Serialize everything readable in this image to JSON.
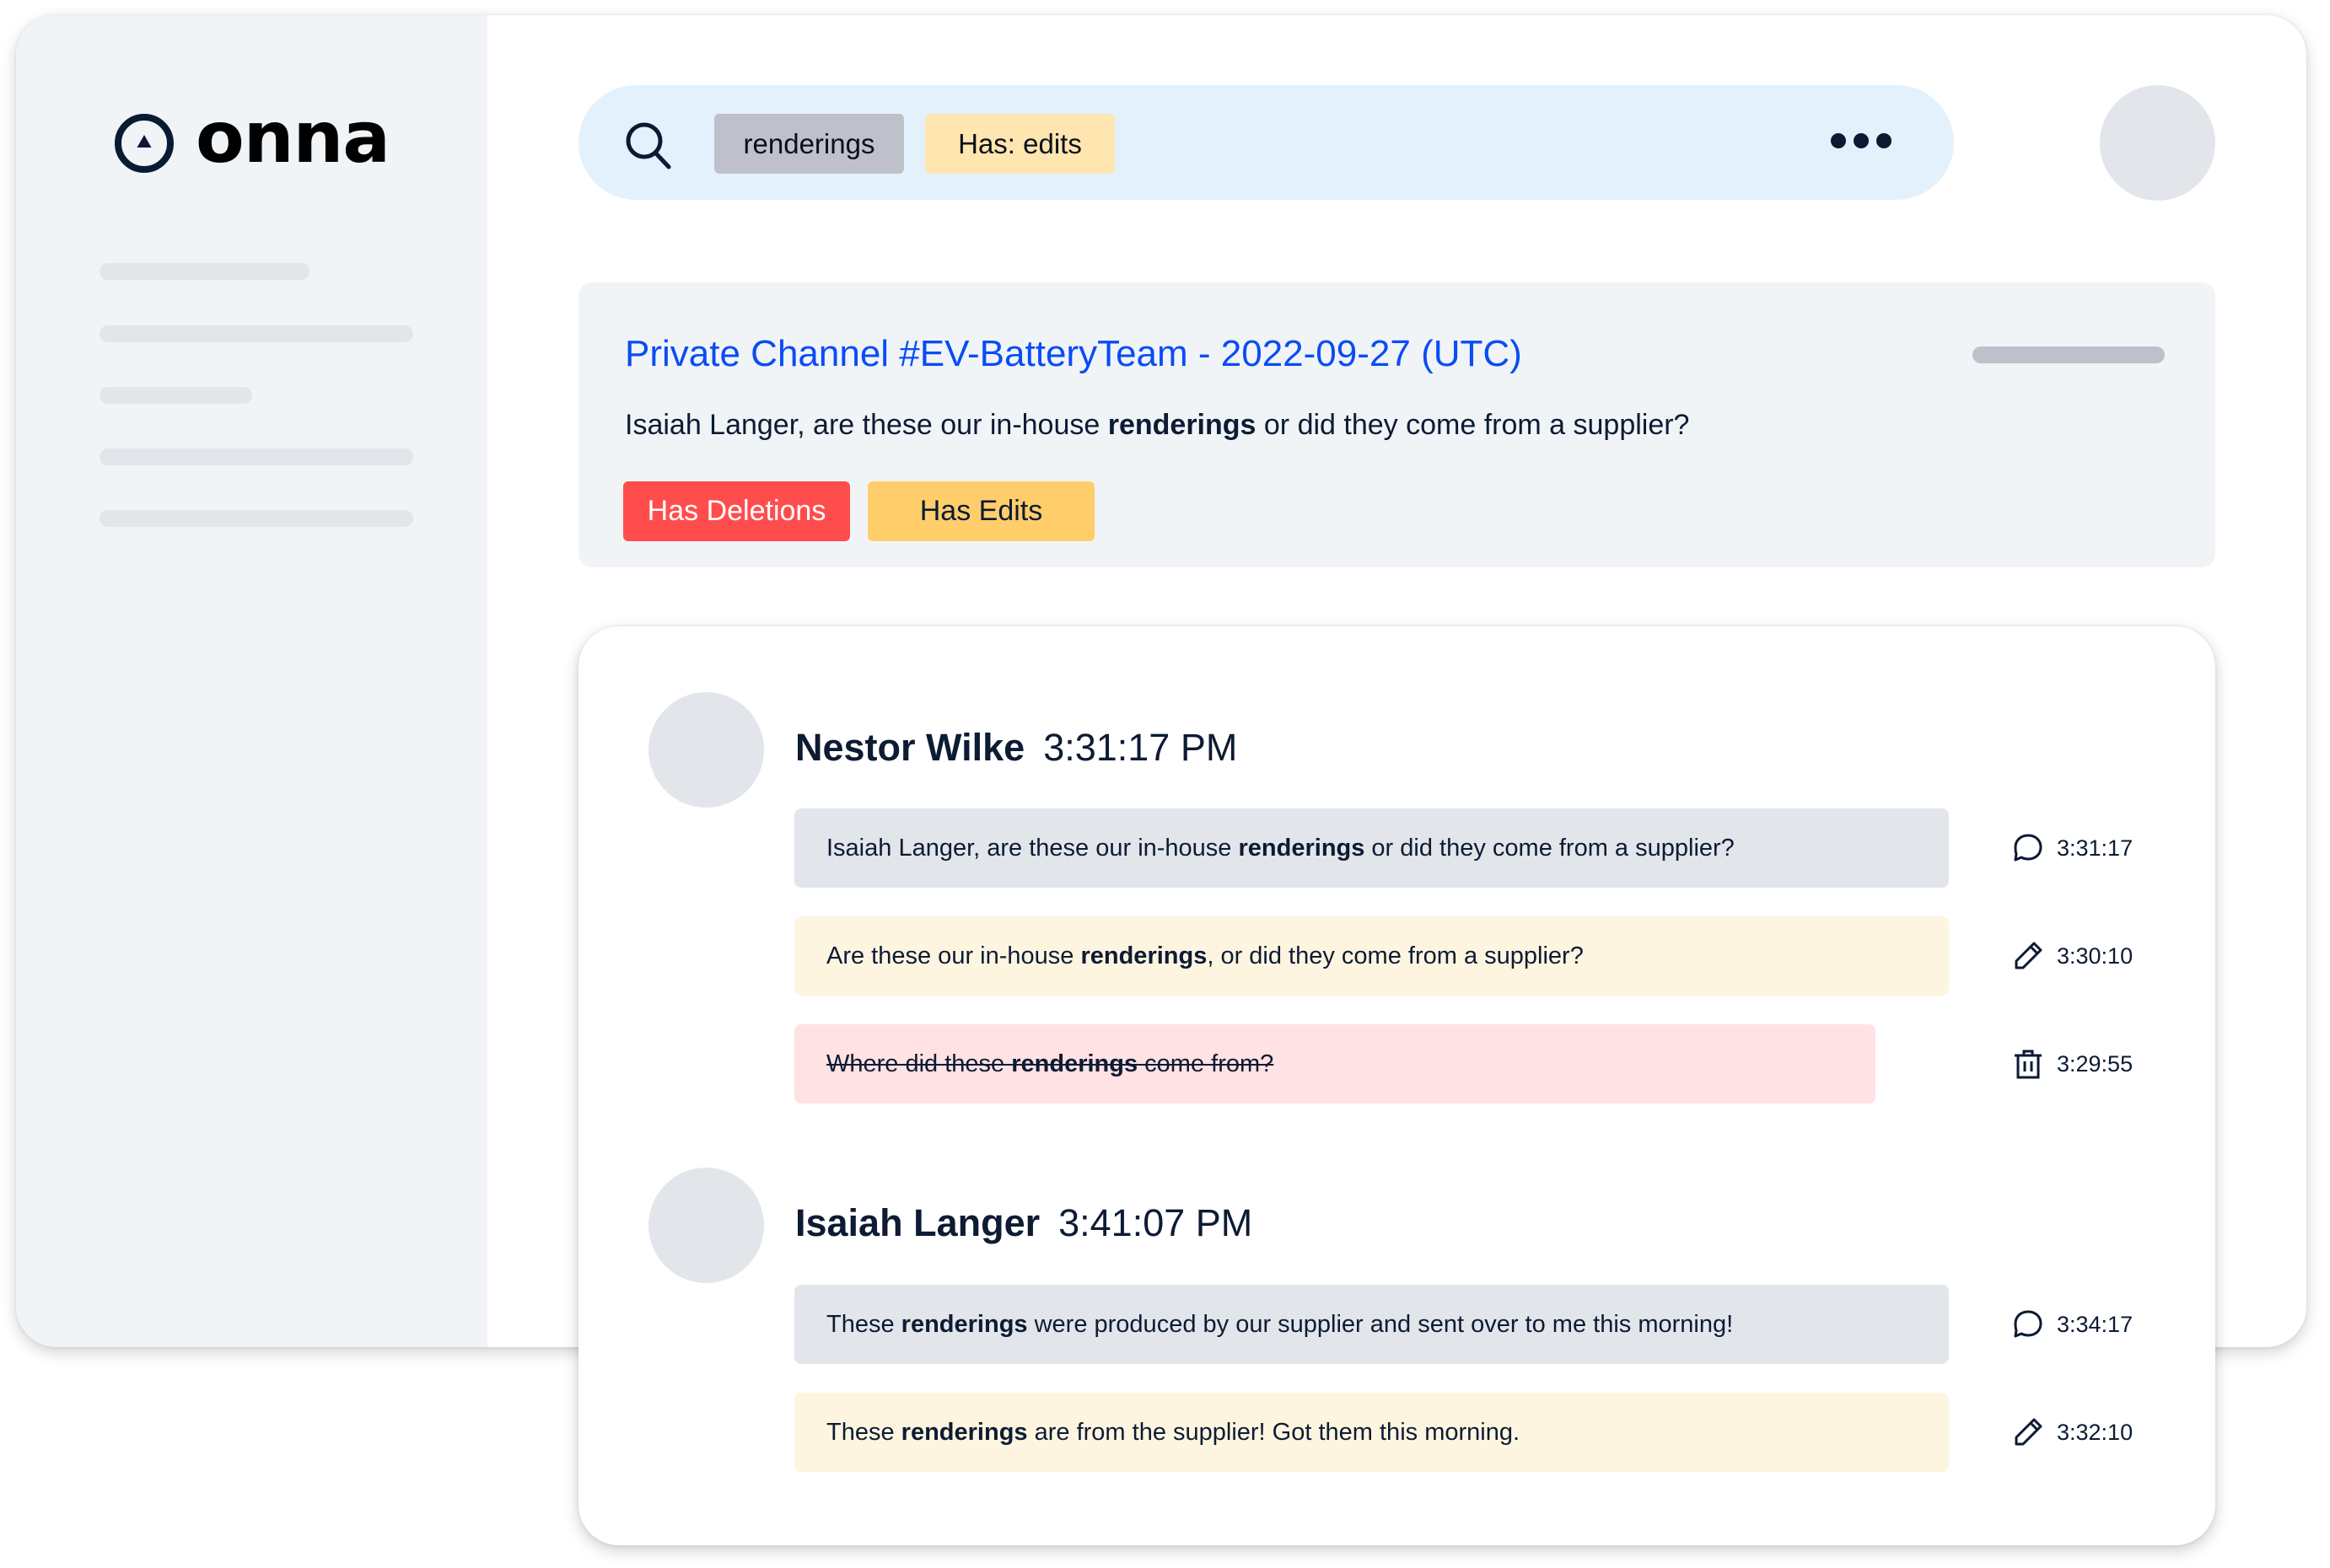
{
  "app": {
    "brand": "onna",
    "colors": {
      "accent_link": "#0a4cf5",
      "deletion": "#ff4d4d",
      "edit": "#ffce6b",
      "sidebar_bg": "#f0f4f7",
      "search_bg": "#e3f1fc"
    }
  },
  "sidebar": {
    "logo_icon": "onna-logo-icon",
    "nav_placeholders": 5
  },
  "search": {
    "icon": "search-icon",
    "chips": [
      {
        "label": "renderings",
        "type": "term"
      },
      {
        "label": "Has: edits",
        "type": "filter"
      }
    ],
    "more_icon": "more-horizontal-icon"
  },
  "result": {
    "title": "Private Channel #EV-BatteryTeam - 2022-09-27 (UTC)",
    "snippet": {
      "before": "Isaiah Langer, are these our in-house ",
      "highlight": "renderings",
      "after": " or did they come from a supplier?"
    },
    "tags": [
      {
        "label": "Has Deletions",
        "color": "#ff4d4d"
      },
      {
        "label": "Has Edits",
        "color": "#ffce6b"
      }
    ]
  },
  "thread": {
    "messages": [
      {
        "author": "Nestor Wilke",
        "time": "3:31:17 PM",
        "versions": [
          {
            "kind": "original",
            "icon": "chat-bubble-icon",
            "time": "3:31:17",
            "before": "Isaiah Langer, are these our in-house ",
            "highlight": "renderings",
            "after": " or did they come from a supplier?"
          },
          {
            "kind": "edited",
            "icon": "pencil-icon",
            "time": "3:30:10",
            "before": "Are these our in-house ",
            "highlight": "renderings",
            "after": ", or did they come from a supplier?"
          },
          {
            "kind": "deleted",
            "icon": "trash-icon",
            "time": "3:29:55",
            "before": "Where did these ",
            "highlight": "renderings",
            "after": " come from?"
          }
        ]
      },
      {
        "author": "Isaiah Langer",
        "time": "3:41:07 PM",
        "versions": [
          {
            "kind": "original",
            "icon": "chat-bubble-icon",
            "time": "3:34:17",
            "before": "These ",
            "highlight": "renderings",
            "after": " were produced by our supplier and sent over to me this morning!"
          },
          {
            "kind": "edited",
            "icon": "pencil-icon",
            "time": "3:32:10",
            "before": "These ",
            "highlight": "renderings",
            "after": " are from the supplier! Got them this morning."
          }
        ]
      }
    ]
  }
}
